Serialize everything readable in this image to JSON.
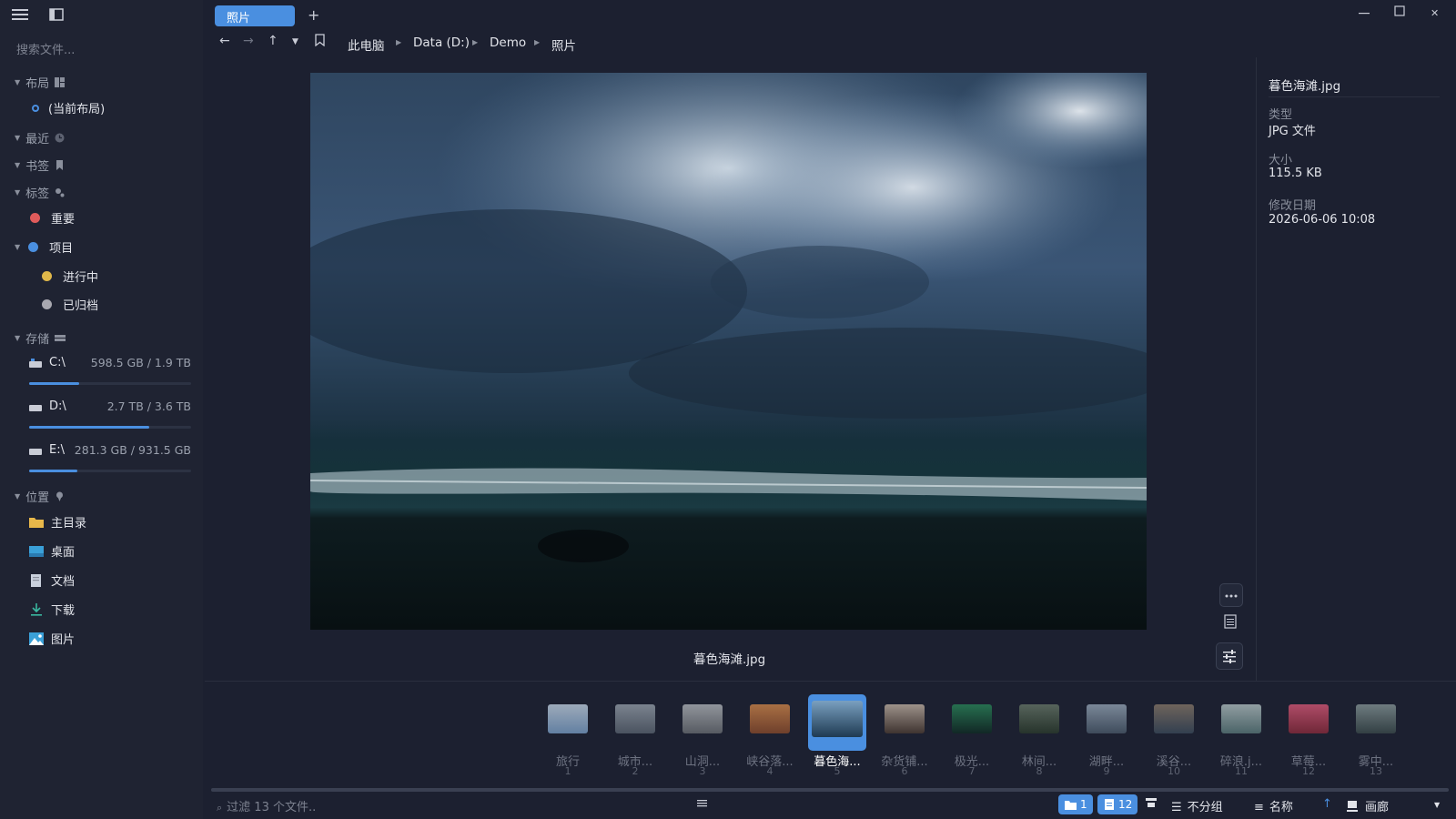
{
  "tab": {
    "title": "照片"
  },
  "sidebar": {
    "search_placeholder": "搜索文件...",
    "sections": {
      "layout": "布局",
      "recent": "最近",
      "bookmarks": "书签",
      "tags": "标签",
      "storage": "存储",
      "locations": "位置"
    },
    "current_layout": "(当前布局)",
    "tags": [
      {
        "label": "重要",
        "color": "#e05b5b"
      },
      {
        "label": "项目",
        "color": "#4a8fe0"
      },
      {
        "label": "进行中",
        "color": "#e0b84a"
      },
      {
        "label": "已归档",
        "color": "#a8a8b0"
      }
    ],
    "drives": [
      {
        "name": "C:\\",
        "size": "598.5 GB / 1.9 TB",
        "usage": 0.31
      },
      {
        "name": "D:\\",
        "size": "2.7 TB / 3.6 TB",
        "usage": 0.74
      },
      {
        "name": "E:\\",
        "size": "281.3 GB / 931.5 GB",
        "usage": 0.3
      }
    ],
    "locations": [
      {
        "label": "主目录",
        "icon": "folder-icon"
      },
      {
        "label": "桌面",
        "icon": "desktop-icon"
      },
      {
        "label": "文档",
        "icon": "document-icon"
      },
      {
        "label": "下载",
        "icon": "download-icon"
      },
      {
        "label": "图片",
        "icon": "pictures-icon"
      }
    ]
  },
  "breadcrumb": [
    "此电脑",
    "Data (D:)",
    "Demo",
    "照片"
  ],
  "preview": {
    "caption": "暮色海滩.jpg"
  },
  "details": {
    "filename": "暮色海滩.jpg",
    "type_label": "类型",
    "type_value": "JPG 文件",
    "size_label": "大小",
    "size_value": "115.5 KB",
    "modified_label": "修改日期",
    "modified_value": "2026-06-06 10:08"
  },
  "thumbnails": [
    {
      "label": "旅行",
      "num": "1"
    },
    {
      "label": "城市...",
      "num": "2"
    },
    {
      "label": "山洞...",
      "num": "3"
    },
    {
      "label": "峡谷落...",
      "num": "4"
    },
    {
      "label": "暮色海...",
      "num": "5",
      "selected": true
    },
    {
      "label": "杂货铺...",
      "num": "6"
    },
    {
      "label": "极光...",
      "num": "7"
    },
    {
      "label": "林间...",
      "num": "8"
    },
    {
      "label": "湖畔...",
      "num": "9"
    },
    {
      "label": "溪谷...",
      "num": "10"
    },
    {
      "label": "碎浪.j...",
      "num": "11"
    },
    {
      "label": "草莓...",
      "num": "12"
    },
    {
      "label": "雾中...",
      "num": "13"
    }
  ],
  "status": {
    "filter_placeholder": "过滤 13 个文件..",
    "folder_count": "1",
    "file_count": "12",
    "group": "不分组",
    "sort": "名称",
    "view": "画廊"
  },
  "colors": {
    "accent": "#4a8fe0",
    "background": "#1c2030",
    "sidebar": "#1f2332"
  }
}
